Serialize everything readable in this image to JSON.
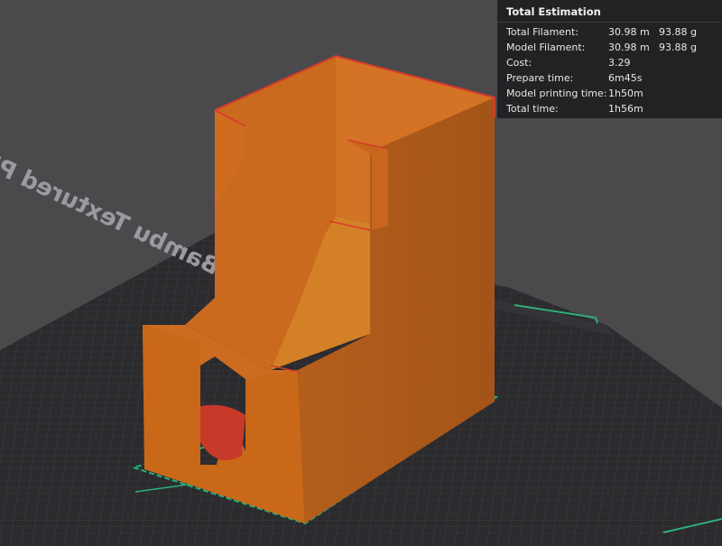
{
  "viewport": {
    "bed_label": "Bambu Textured PEI Plate",
    "model_color": "#cc6a1d",
    "bed_color": "#2b2b2e",
    "background_color": "#4a4a4d"
  },
  "estimation": {
    "title": "Total Estimation",
    "rows": [
      {
        "label": "Total Filament:",
        "value1": "30.98 m",
        "value2": "93.88 g"
      },
      {
        "label": "Model Filament:",
        "value1": "30.98 m",
        "value2": "93.88 g"
      },
      {
        "label": "Cost:",
        "value1": "3.29",
        "value2": ""
      },
      {
        "label": "Prepare time:",
        "value1": "6m45s",
        "value2": ""
      },
      {
        "label": "Model printing time:",
        "value1": "1h50m",
        "value2": ""
      },
      {
        "label": "Total time:",
        "value1": "1h56m",
        "value2": ""
      }
    ]
  }
}
